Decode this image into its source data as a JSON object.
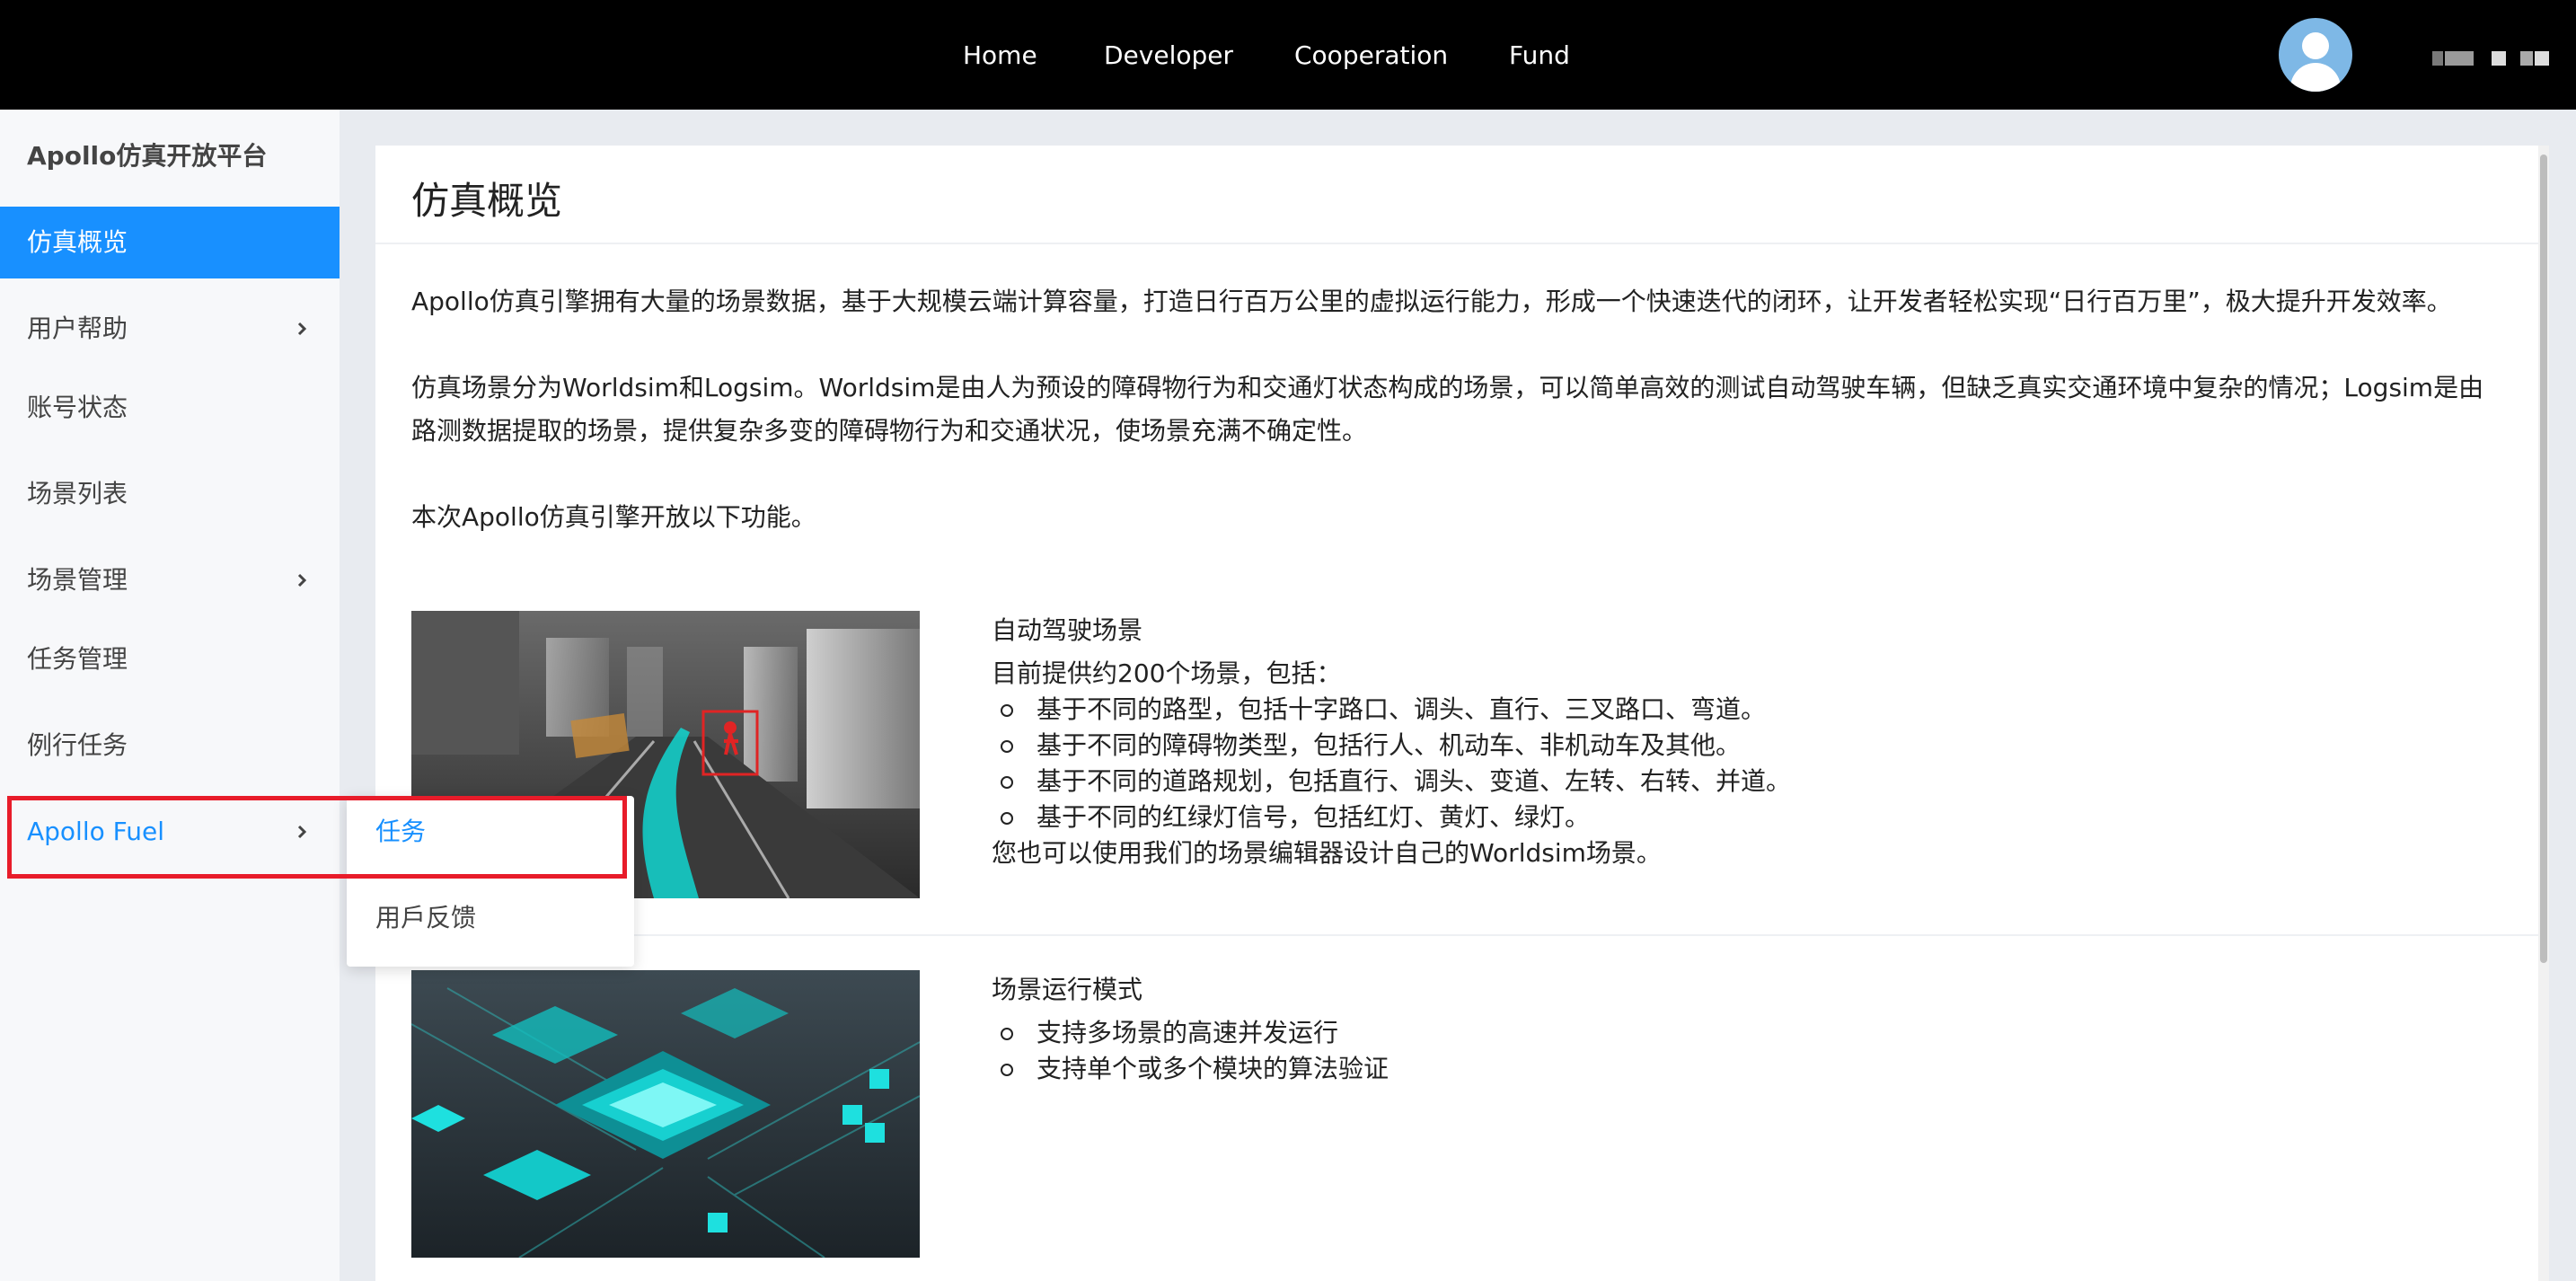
{
  "nav": {
    "links": [
      "Home",
      "Developer",
      "Cooperation",
      "Fund"
    ]
  },
  "sidebar": {
    "brand": "Apollo仿真开放平台",
    "items": [
      {
        "label": "仿真概览",
        "active": true,
        "has_children": false
      },
      {
        "label": "用户帮助",
        "active": false,
        "has_children": true
      },
      {
        "label": "账号状态",
        "active": false,
        "has_children": false
      },
      {
        "label": "场景列表",
        "active": false,
        "has_children": false
      },
      {
        "label": "场景管理",
        "active": false,
        "has_children": true
      },
      {
        "label": "任务管理",
        "active": false,
        "has_children": false
      },
      {
        "label": "例行任务",
        "active": false,
        "has_children": false
      },
      {
        "label": "Apollo Fuel",
        "active": false,
        "has_children": true
      }
    ]
  },
  "submenu": {
    "items": [
      "任务",
      "用戶反馈"
    ]
  },
  "main": {
    "title": "仿真概览",
    "paragraphs": [
      "Apollo仿真引擎拥有大量的场景数据，基于大规模云端计算容量，打造日行百万公里的虚拟运行能力，形成一个快速迭代的闭环，让开发者轻松实现“日行百万里”，极大提升开发效率。",
      "仿真场景分为Worldsim和Logsim。Worldsim是由人为预设的障碍物行为和交通灯状态构成的场景，可以简单高效的测试自动驾驶车辆，但缺乏真实交通环境中复杂的情况；Logsim是由路测数据提取的场景，提供复杂多变的障碍物行为和交通状况，使场景充满不确定性。",
      "本次Apollo仿真引擎开放以下功能。"
    ],
    "features": [
      {
        "title": "自动驾驶场景",
        "subtitle": "目前提供约200个场景，包括：",
        "bullets": [
          "基于不同的路型，包括十字路口、调头、直行、三叉路口、弯道。",
          "基于不同的障碍物类型，包括行人、机动车、非机动车及其他。",
          "基于不同的道路规划，包括直行、调头、变道、左转、右转、并道。",
          "基于不同的红绿灯信号，包括红灯、黄灯、绿灯。"
        ],
        "footer": "您也可以使用我们的场景编辑器设计自己的Worldsim场景。",
        "image": "autonomous-driving-scene-illustration"
      },
      {
        "title": "场景运行模式",
        "bullets": [
          "支持多场景的高速并发运行",
          "支持单个或多个模块的算法验证"
        ],
        "image": "cloud-compute-chip-illustration"
      }
    ]
  },
  "colors": {
    "accent": "#1890ff",
    "topbar": "#000000",
    "highlight": "#e81c2a"
  }
}
